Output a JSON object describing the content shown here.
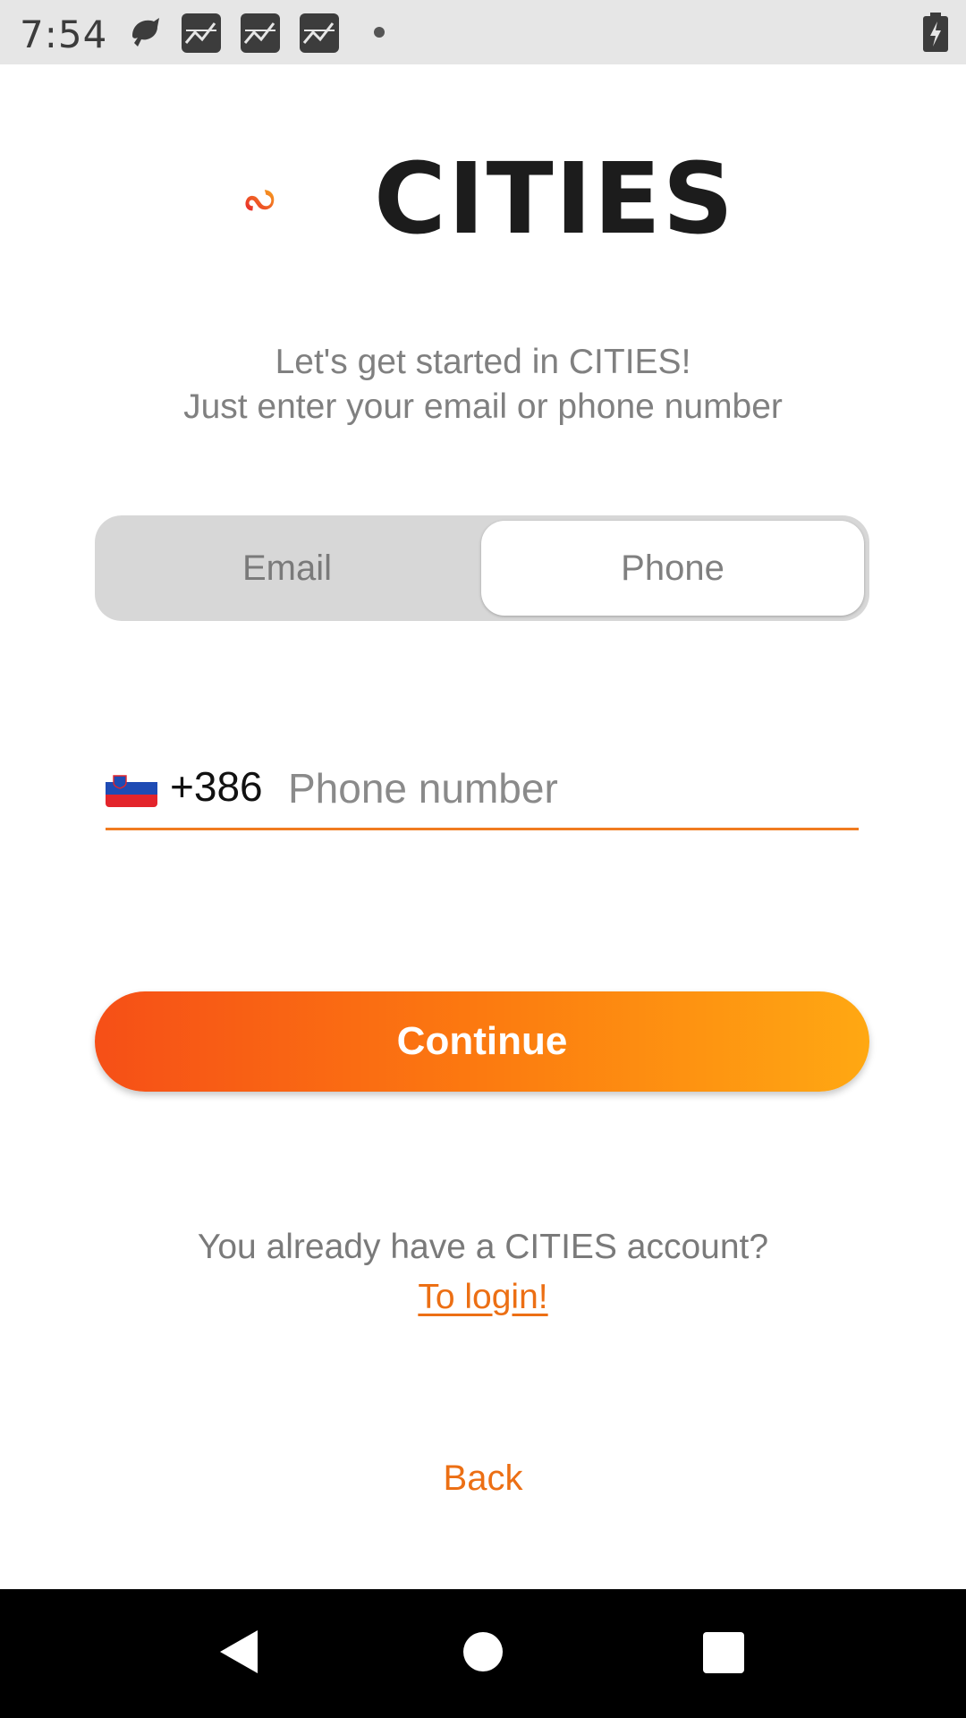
{
  "status_bar": {
    "time": "7:54",
    "icons": [
      "bird-notification-icon",
      "chart-app-icon",
      "chart-app-icon",
      "chart-app-icon",
      "dot-icon",
      "battery-charging-icon"
    ]
  },
  "logo": {
    "wordmark": "CITIES",
    "colors": {
      "orange": "#f7931e",
      "red": "#e8262c"
    }
  },
  "intro": {
    "line1": "Let's get started in CITIES!",
    "line2": "Just enter your email or phone number"
  },
  "toggle": {
    "email_label": "Email",
    "phone_label": "Phone",
    "selected": "Phone"
  },
  "phone_field": {
    "flag": "slovenia-flag-icon",
    "dial_code": "+386",
    "placeholder": "Phone number",
    "value": ""
  },
  "continue_button": {
    "label": "Continue"
  },
  "login": {
    "question": "You already have a CITIES account?",
    "link_label": "To login!"
  },
  "back_label": "Back",
  "nav_bar": {
    "icons": [
      "back-icon",
      "home-icon",
      "recent-apps-icon"
    ]
  },
  "colors": {
    "accent": "#ec6f14",
    "gradient_start": "#f64f17",
    "gradient_end": "#ffa812"
  }
}
